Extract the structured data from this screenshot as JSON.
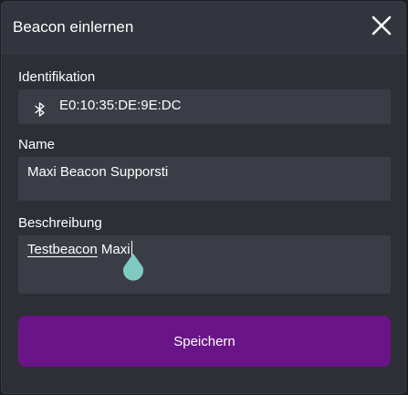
{
  "dialog": {
    "title": "Beacon einlernen",
    "close_icon": "close-icon"
  },
  "identification": {
    "label": "Identifikation",
    "icon": "bluetooth-icon",
    "value": "E0:10:35:DE:9E:DC"
  },
  "name": {
    "label": "Name",
    "value": "Maxi Beacon Supporsti"
  },
  "description": {
    "label": "Beschreibung",
    "value_word1": "Testbeacon",
    "value_word2": "Maxi"
  },
  "save": {
    "label": "Speichern"
  },
  "colors": {
    "dialog_bg": "#2c2f36",
    "field_bg": "#3a3d45",
    "accent": "#6a1587",
    "text_handle": "#7fcbc4"
  }
}
